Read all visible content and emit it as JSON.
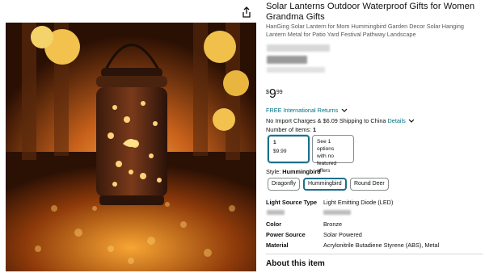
{
  "product": {
    "title": "Solar Lanterns Outdoor Waterproof Gifts for Women Grandma Gifts",
    "subtitle": "HanGing Solar Lantern for Mom Hummingbird Garden Decor Solar Hanging Lantern Metal for Patio Yard Festival Pathway Landscape",
    "image_alt": "solar-lantern-photo"
  },
  "price": {
    "currency": "$",
    "whole": "9",
    "fraction": "99"
  },
  "shipping": {
    "returns_label": "FREE International Returns",
    "import_text": "No Import Charges & $6.09 Shipping to China",
    "details_link": "Details"
  },
  "quantity": {
    "label": "Number of Items:",
    "value": "1",
    "option_selected": {
      "count": "1",
      "price": "$9.99"
    },
    "option_alt": {
      "line1": "See 1 options",
      "line2": "with no",
      "line3": "featured offers"
    }
  },
  "style": {
    "label": "Style:",
    "selected": "Hummingbird",
    "options": [
      "Dragonfly",
      "Hummingbird",
      "Round Deer"
    ]
  },
  "specs": [
    {
      "key": "Light Source Type",
      "value": "Light Emitting Diode (LED)"
    },
    {
      "key": "Color",
      "value": "Bronze"
    },
    {
      "key": "Power Source",
      "value": "Solar Powered"
    },
    {
      "key": "Material",
      "value": "Acrylonitrile Butadiene Styrene (ABS), Metal"
    }
  ],
  "about_heading": "About this item",
  "icons": {
    "share": "share-icon",
    "returns_chevron": "chevron-down-icon",
    "details_chevron": "chevron-down-icon"
  },
  "colors": {
    "link": "#007185",
    "selected_border": "#1e6f8c",
    "text": "#0f1111"
  }
}
